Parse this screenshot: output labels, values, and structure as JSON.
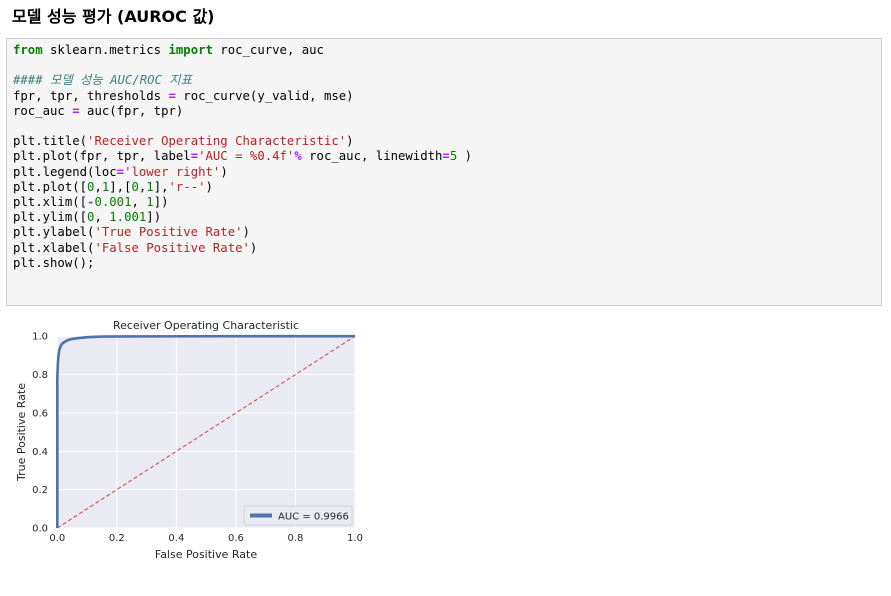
{
  "heading": "모델 성능 평가 (AUROC 값)",
  "code_lines": [
    [
      {
        "t": "from",
        "c": "kw"
      },
      {
        "t": " sklearn.metrics "
      },
      {
        "t": "import",
        "c": "kw"
      },
      {
        "t": " roc_curve, auc"
      }
    ],
    [],
    [
      {
        "t": "#### 모델 성능 AUC/ROC 지표",
        "c": "cm"
      }
    ],
    [
      {
        "t": "fpr, tpr, thresholds "
      },
      {
        "t": "=",
        "c": "op"
      },
      {
        "t": " roc_curve(y_valid, mse)"
      }
    ],
    [
      {
        "t": "roc_auc "
      },
      {
        "t": "=",
        "c": "op"
      },
      {
        "t": " auc(fpr, tpr)"
      }
    ],
    [],
    [
      {
        "t": "plt.title("
      },
      {
        "t": "'Receiver Operating Characteristic'",
        "c": "st"
      },
      {
        "t": ")"
      }
    ],
    [
      {
        "t": "plt.plot(fpr, tpr, label"
      },
      {
        "t": "=",
        "c": "op"
      },
      {
        "t": "'AUC = %0.4f'",
        "c": "st"
      },
      {
        "t": "% ",
        "c": "op"
      },
      {
        "t": "roc_auc, linewidth"
      },
      {
        "t": "=",
        "c": "op"
      },
      {
        "t": "5",
        "c": "nm"
      },
      {
        "t": " )"
      }
    ],
    [
      {
        "t": "plt.legend(loc"
      },
      {
        "t": "=",
        "c": "op"
      },
      {
        "t": "'lower right'",
        "c": "st"
      },
      {
        "t": ")"
      }
    ],
    [
      {
        "t": "plt.plot(["
      },
      {
        "t": "0",
        "c": "nm"
      },
      {
        "t": ","
      },
      {
        "t": "1",
        "c": "nm"
      },
      {
        "t": "],["
      },
      {
        "t": "0",
        "c": "nm"
      },
      {
        "t": ","
      },
      {
        "t": "1",
        "c": "nm"
      },
      {
        "t": "],"
      },
      {
        "t": "'r--'",
        "c": "st"
      },
      {
        "t": ")"
      }
    ],
    [
      {
        "t": "plt.xlim(["
      },
      {
        "t": "-",
        "c": "op"
      },
      {
        "t": "0.001",
        "c": "nm"
      },
      {
        "t": ", "
      },
      {
        "t": "1",
        "c": "nm"
      },
      {
        "t": "])"
      }
    ],
    [
      {
        "t": "plt.ylim(["
      },
      {
        "t": "0",
        "c": "nm"
      },
      {
        "t": ", "
      },
      {
        "t": "1.001",
        "c": "nm"
      },
      {
        "t": "])"
      }
    ],
    [
      {
        "t": "plt.ylabel("
      },
      {
        "t": "'True Positive Rate'",
        "c": "st"
      },
      {
        "t": ")"
      }
    ],
    [
      {
        "t": "plt.xlabel("
      },
      {
        "t": "'False Positive Rate'",
        "c": "st"
      },
      {
        "t": ")"
      }
    ],
    [
      {
        "t": "plt.show();"
      }
    ]
  ],
  "chart_data": {
    "type": "line",
    "title": "Receiver Operating Characteristic",
    "xlabel": "False Positive Rate",
    "ylabel": "True Positive Rate",
    "xlim": [
      -0.001,
      1
    ],
    "ylim": [
      0,
      1.001
    ],
    "xticks": [
      "0.0",
      "0.2",
      "0.4",
      "0.6",
      "0.8",
      "1.0"
    ],
    "yticks": [
      "0.0",
      "0.2",
      "0.4",
      "0.6",
      "0.8",
      "1.0"
    ],
    "grid": true,
    "legend_position": "lower right",
    "series": [
      {
        "name": "AUC = 0.9966",
        "color": "#4c72b0",
        "style": "solid",
        "x": [
          0.0,
          0.0,
          0.002,
          0.004,
          0.006,
          0.008,
          0.012,
          0.016,
          0.022,
          0.03,
          0.04,
          0.055,
          0.075,
          0.1,
          0.15,
          0.3,
          0.6,
          1.0
        ],
        "y": [
          0.0,
          0.78,
          0.86,
          0.9,
          0.92,
          0.935,
          0.95,
          0.96,
          0.968,
          0.975,
          0.982,
          0.987,
          0.991,
          0.995,
          0.998,
          0.999,
          1.0,
          1.0
        ]
      },
      {
        "name": "",
        "color": "#d65f5f",
        "style": "dashed",
        "x": [
          0,
          1
        ],
        "y": [
          0,
          1
        ]
      }
    ]
  }
}
